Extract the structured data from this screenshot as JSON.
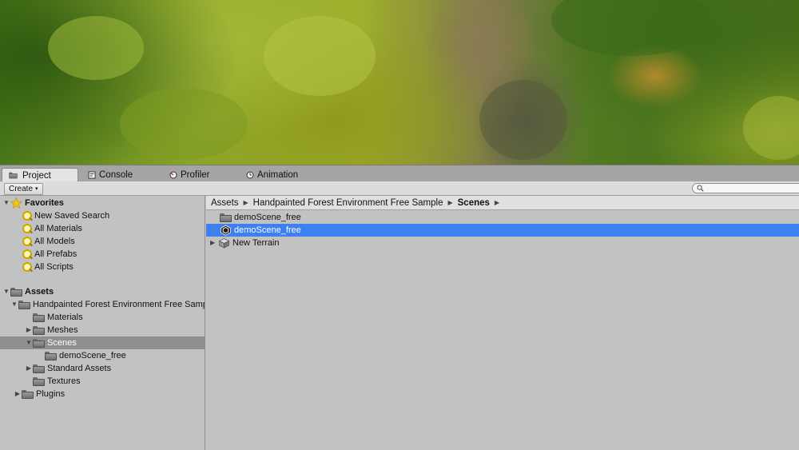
{
  "tabs": [
    {
      "label": "Project",
      "icon": "folder-icon",
      "active": true
    },
    {
      "label": "Console",
      "icon": "console-icon",
      "active": false
    },
    {
      "label": "Profiler",
      "icon": "profiler-icon",
      "active": false
    },
    {
      "label": "Animation",
      "icon": "clock-icon",
      "active": false
    }
  ],
  "toolbar": {
    "create_label": "Create",
    "search_placeholder": ""
  },
  "tree": {
    "favorites_label": "Favorites",
    "favorites": [
      "New Saved Search",
      "All Materials",
      "All Models",
      "All Prefabs",
      "All Scripts"
    ],
    "assets_label": "Assets",
    "assets": [
      {
        "label": "Handpainted Forest Environment Free Sample",
        "depth": 1,
        "expanded": true
      },
      {
        "label": "Materials",
        "depth": 2
      },
      {
        "label": "Meshes",
        "depth": 2,
        "collapsed": true
      },
      {
        "label": "Scenes",
        "depth": 2,
        "expanded": true,
        "selected": true
      },
      {
        "label": "demoScene_free",
        "depth": 3
      },
      {
        "label": "Standard Assets",
        "depth": 2,
        "collapsed": true
      },
      {
        "label": "Textures",
        "depth": 2
      },
      {
        "label": "Plugins",
        "depth": 1,
        "collapsed": true
      }
    ]
  },
  "breadcrumb": [
    "Assets",
    "Handpainted Forest Environment Free Sample",
    "Scenes"
  ],
  "items": [
    {
      "label": "demoScene_free",
      "icon": "folder-icon"
    },
    {
      "label": "demoScene_free",
      "icon": "unity-scene-icon",
      "selected": true
    },
    {
      "label": "New Terrain",
      "icon": "terrain-icon",
      "collapsed": true
    }
  ],
  "colors": {
    "selection": "#3d80f2",
    "tree_selection": "#8f8f8f",
    "panel": "#c2c2c2"
  }
}
